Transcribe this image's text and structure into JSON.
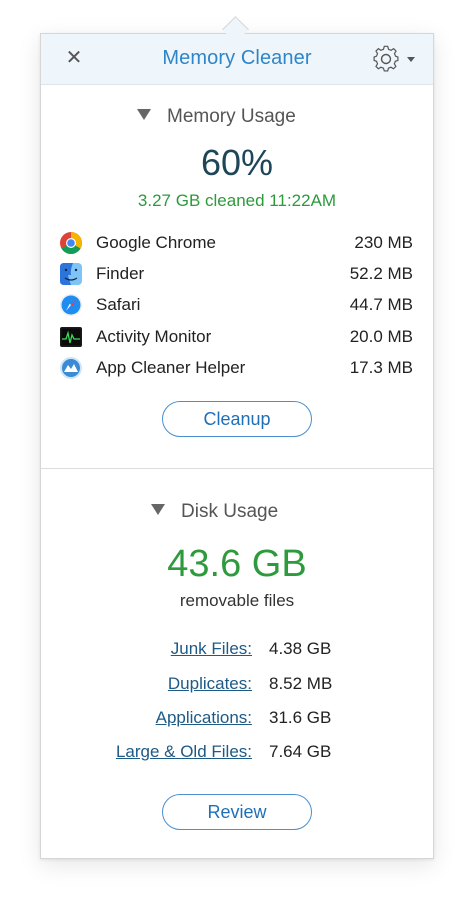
{
  "header": {
    "title": "Memory Cleaner",
    "close_icon": "close-icon",
    "settings_icon": "gear-icon"
  },
  "memory": {
    "section_label": "Memory Usage",
    "percent": "60%",
    "cleaned_text": "3.27 GB cleaned 11:22AM",
    "apps": [
      {
        "name": "Google Chrome",
        "size": "230 MB",
        "icon": "chrome-icon"
      },
      {
        "name": "Finder",
        "size": "52.2 MB",
        "icon": "finder-icon"
      },
      {
        "name": "Safari",
        "size": "44.7 MB",
        "icon": "safari-icon"
      },
      {
        "name": "Activity Monitor",
        "size": "20.0 MB",
        "icon": "activity-monitor-icon"
      },
      {
        "name": "App Cleaner Helper",
        "size": "17.3 MB",
        "icon": "app-cleaner-helper-icon"
      }
    ],
    "button_label": "Cleanup"
  },
  "disk": {
    "section_label": "Disk Usage",
    "total": "43.6 GB",
    "total_caption": "removable files",
    "items": [
      {
        "label": "Junk Files:",
        "value": "4.38 GB"
      },
      {
        "label": "Duplicates:",
        "value": "8.52 MB"
      },
      {
        "label": "Applications:",
        "value": "31.6 GB"
      },
      {
        "label": "Large & Old Files:",
        "value": "7.64 GB"
      }
    ],
    "button_label": "Review"
  },
  "colors": {
    "title": "#2e86c8",
    "percent": "#1e4558",
    "green": "#2d9a3c",
    "link": "#1d5a86",
    "header_bg": "#eef5fb"
  }
}
